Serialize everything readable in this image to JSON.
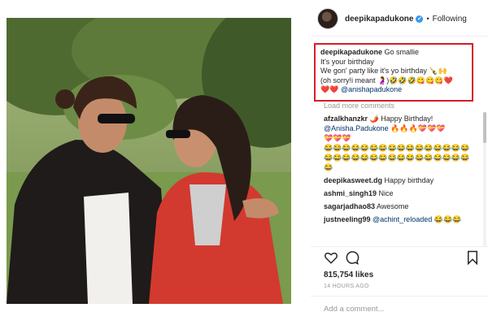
{
  "post": {
    "username": "deepikapadukone",
    "follow_label": "Following",
    "separator": "•",
    "verified_mark": "✓"
  },
  "caption": {
    "username": "deepikapadukone",
    "line1": "Go smallie",
    "line2": "It's your birthday",
    "line3": "We gon' party like it's yo birthday 🍾🙌",
    "line4": "(oh sorry!i meant 🤰)🤣🤣🤣😋😋😋❤️",
    "hearts": "❤️❤️",
    "mention": "@anishapadukone"
  },
  "load_more": "Load more comments",
  "comments": [
    {
      "user": "afzalkhanzkr",
      "text": "🌶️ Happy Birthday!"
    },
    {
      "user": "",
      "text": "🔥🔥🔥💝💝💝",
      "mention": "@Anisha.Padukone"
    },
    {
      "user": "deepikasweet.dg",
      "text": "Happy birthday"
    },
    {
      "user": "ashmi_singh19",
      "text": "Nice"
    },
    {
      "user": "sagarjadhao83",
      "text": "Awesome"
    },
    {
      "user": "justneeling99",
      "text": "😂😂😂",
      "mention": "@achint_reloaded"
    }
  ],
  "emoji_rows": {
    "row1": "💝💝💝",
    "rows": "😂😂😂😂😂😂😂😂😂😂😂😂😂😂😂😂😂😂😂😂😂😂😂😂😂😂😂😂😂😂😂😂😂"
  },
  "likes": "815,754 likes",
  "timestamp": "14 HOURS AGO",
  "add_comment_placeholder": "Add a comment...",
  "colors": {
    "highlight": "#d21f26",
    "verified": "#3897f0",
    "mention": "#003569"
  }
}
